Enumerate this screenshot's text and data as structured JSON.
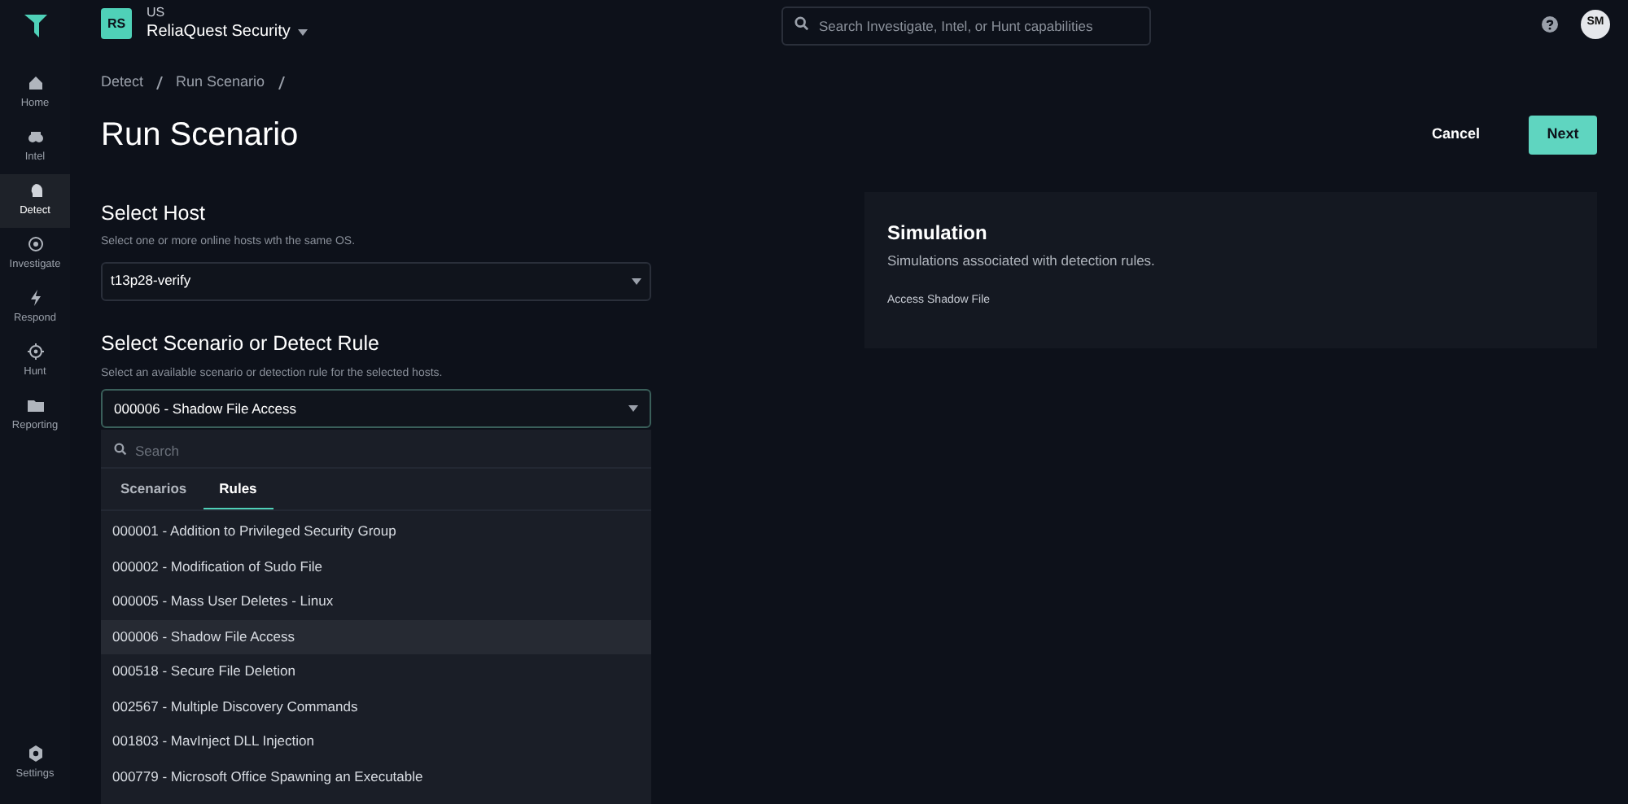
{
  "sidebar": {
    "items": [
      {
        "kind": "home",
        "label": "Home",
        "selected": false
      },
      {
        "kind": "intel",
        "label": "Intel",
        "selected": false
      },
      {
        "kind": "detect",
        "label": "Detect",
        "selected": true
      },
      {
        "kind": "investigate",
        "label": "Investigate",
        "selected": false
      },
      {
        "kind": "respond",
        "label": "Respond",
        "selected": false
      },
      {
        "kind": "hunt",
        "label": "Hunt",
        "selected": false
      },
      {
        "kind": "reporting",
        "label": "Reporting",
        "selected": false
      }
    ],
    "footer": {
      "kind": "settings",
      "label": "Settings"
    }
  },
  "header": {
    "org_badge": "RS",
    "region": "US",
    "org_name": "ReliaQuest Security",
    "search": {
      "placeholder": "Search Investigate, Intel, or Hunt capabilities"
    },
    "avatar": "SM"
  },
  "breadcrumbs": [
    "Detect",
    "Run Scenario"
  ],
  "title": "Run Scenario",
  "buttons": {
    "cancel": "Cancel",
    "next": "Next"
  },
  "host": {
    "heading": "Select Host",
    "hint": "Select one or more online hosts wth the same OS.",
    "value": "t13p28-verify"
  },
  "rule": {
    "heading": "Select Scenario or Detect Rule",
    "hint": "Select an available scenario or detection rule for the selected hosts.",
    "value": "000006 - Shadow File Access",
    "dropdown": {
      "search": {
        "placeholder": "Search"
      },
      "tabs": [
        {
          "label": "Scenarios",
          "selected": false
        },
        {
          "label": "Rules",
          "selected": true
        }
      ],
      "options": [
        {
          "label": "000001 - Addition to Privileged Security Group",
          "selected": false
        },
        {
          "label": "000002 - Modification of Sudo File",
          "selected": false
        },
        {
          "label": "000005 - Mass User Deletes - Linux",
          "selected": false
        },
        {
          "label": "000006 - Shadow File Access",
          "selected": true
        },
        {
          "label": "000518 - Secure File Deletion",
          "selected": false
        },
        {
          "label": "002567 - Multiple Discovery Commands",
          "selected": false
        },
        {
          "label": "001803 - MavInject DLL Injection",
          "selected": false
        },
        {
          "label": "000779 - Microsoft Office Spawning an Executable",
          "selected": false
        }
      ]
    }
  },
  "simulation": {
    "heading": "Simulation",
    "subtitle": "Simulations associated with detection rules.",
    "items": [
      "Access Shadow File"
    ]
  }
}
